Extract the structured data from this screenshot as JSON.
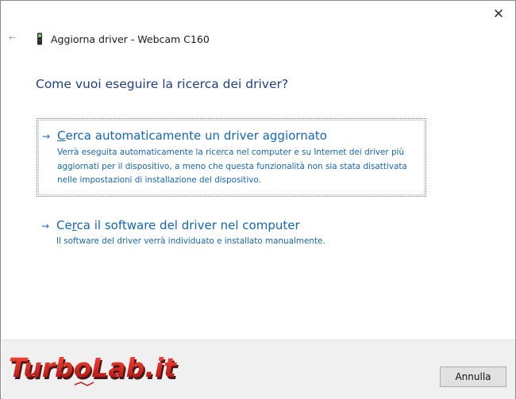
{
  "window": {
    "title": "Aggiorna driver - Webcam C160",
    "close_glyph": "✕",
    "back_glyph": "←"
  },
  "heading": "Come vuoi eseguire la ricerca dei driver?",
  "options": [
    {
      "arrow": "→",
      "accelerator": "C",
      "title_rest": "erca automaticamente un driver aggiornato",
      "description": "Verrà eseguita automaticamente la ricerca nel computer e su Internet dei driver più aggiornati per il dispositivo, a meno che questa funzionalità non sia stata disattivata nelle impostazioni di installazione del dispositivo."
    },
    {
      "arrow": "→",
      "title_start": "Ce",
      "accelerator": "r",
      "title_rest": "ca il software del driver nel computer",
      "description": "Il software del driver verrà individuato e installato manualmente."
    }
  ],
  "footer": {
    "cancel_label": "Annulla"
  },
  "watermark": {
    "text": "TurboLab.it"
  },
  "colors": {
    "heading": "#1f3f83",
    "link": "#1567b2",
    "footer_bg": "#f0f0f0",
    "watermark_red": "#c41e1e",
    "watermark_shadow": "#3a0000"
  },
  "icons": {
    "close": "close-icon",
    "back": "back-arrow-icon",
    "device": "webcam-device-icon",
    "option_arrow": "arrow-right-icon"
  }
}
